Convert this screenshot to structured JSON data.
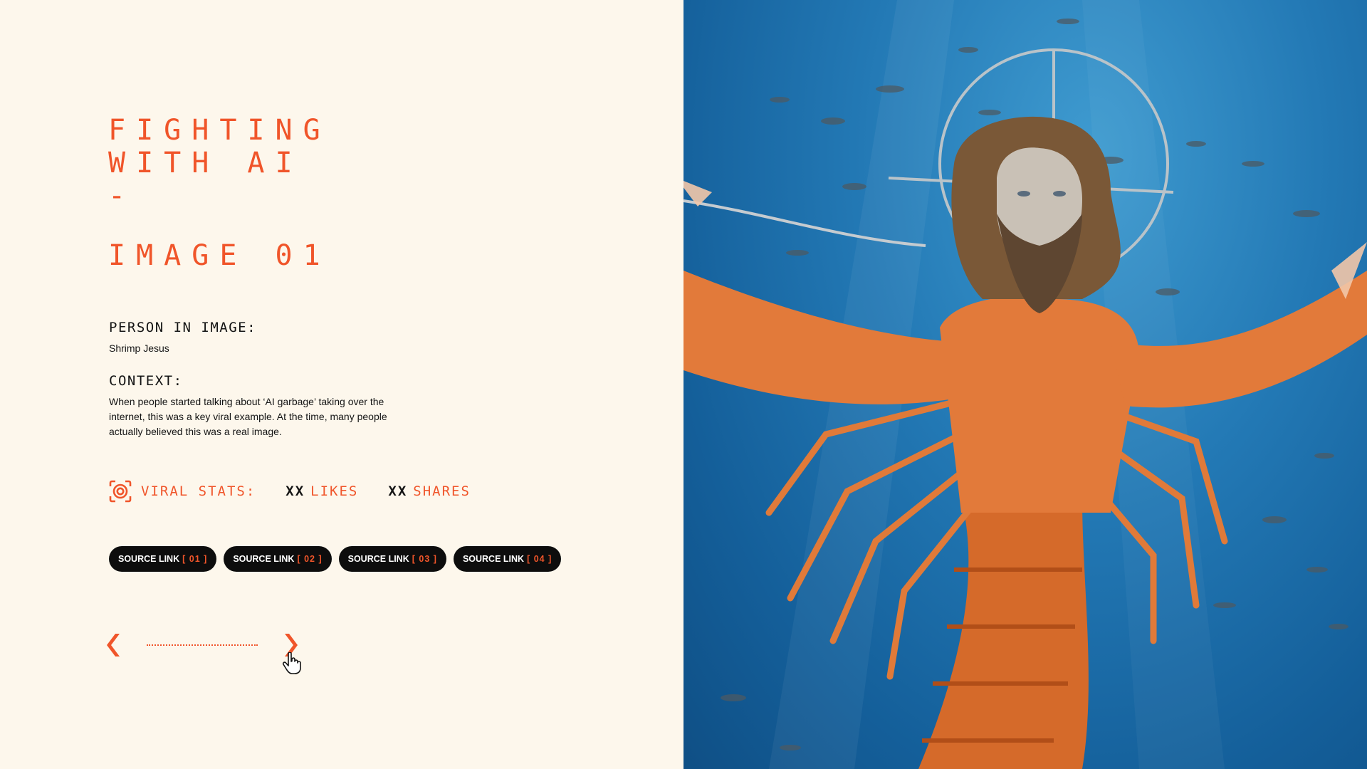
{
  "title": {
    "line1": "FIGHTING",
    "line2": "WITH AI",
    "line3": "-",
    "line4": "IMAGE 01"
  },
  "person": {
    "label": "PERSON IN IMAGE:",
    "value": "Shrimp Jesus"
  },
  "context": {
    "label": "CONTEXT:",
    "value": "When people started talking about ‘AI garbage’ taking over the internet, this was a key viral example. At the time, many people actually believed this was a real image."
  },
  "viral_stats": {
    "icon": "target-icon",
    "label": "VIRAL STATS:",
    "likes_value": "XX",
    "likes_label": "LIKES",
    "shares_value": "XX",
    "shares_label": "SHARES"
  },
  "sources": [
    {
      "label": "SOURCE LINK",
      "index": "[ 01 ]"
    },
    {
      "label": "SOURCE LINK",
      "index": "[ 02 ]"
    },
    {
      "label": "SOURCE LINK",
      "index": "[ 03 ]"
    },
    {
      "label": "SOURCE LINK",
      "index": "[ 04 ]"
    }
  ],
  "pager": {
    "prev_icon": "chevron-left-icon",
    "next_icon": "chevron-right-icon",
    "cursor_icon": "hand-pointer-icon"
  },
  "image": {
    "subject": "shrimp-jesus-image"
  },
  "colors": {
    "accent": "#f0552a",
    "background": "#fdf7ec",
    "ink": "#141414",
    "pill": "#0d0d0d"
  }
}
